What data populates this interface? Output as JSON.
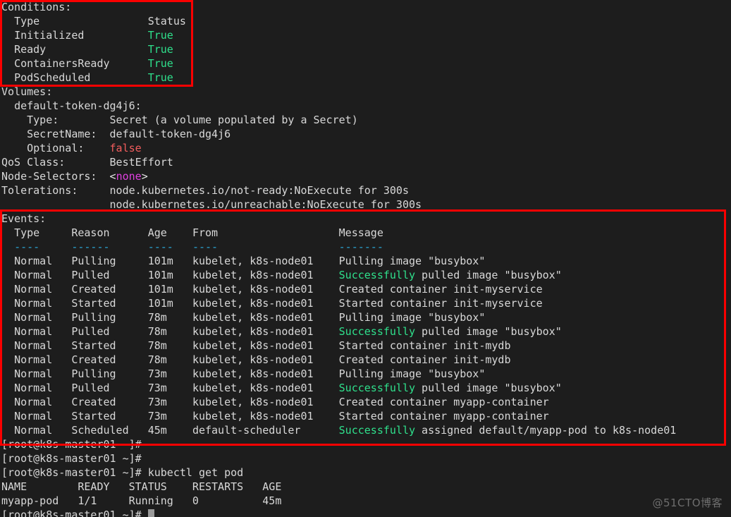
{
  "terminal": {
    "background_color": "#1d1d1d",
    "foreground_color": "#d8d8d8",
    "accent_colors": {
      "true_green": "#2fe08c",
      "false_red": "#f25d5d",
      "none_magenta": "#e040e0",
      "header_rule_cyan": "#2ba8d8",
      "annotation_red": "#fa0000"
    }
  },
  "conditions": {
    "heading": "Conditions:",
    "columns": {
      "type": "Type",
      "status": "Status"
    },
    "rows": [
      {
        "type": "Initialized",
        "status": "True"
      },
      {
        "type": "Ready",
        "status": "True"
      },
      {
        "type": "ContainersReady",
        "status": "True"
      },
      {
        "type": "PodScheduled",
        "status": "True"
      }
    ]
  },
  "volumes": {
    "heading": "Volumes:",
    "name": "default-token-dg4j6:",
    "fields": [
      {
        "key": "Type:",
        "value": "Secret (a volume populated by a Secret)"
      },
      {
        "key": "SecretName:",
        "value": "default-token-dg4j6"
      },
      {
        "key": "Optional:",
        "value": "false"
      }
    ]
  },
  "pod_meta": {
    "qos_label": "QoS Class:",
    "qos_value": "BestEffort",
    "node_selectors_label": "Node-Selectors:",
    "node_selectors_value": "<none>",
    "tolerations_label": "Tolerations:",
    "tolerations_values": [
      "node.kubernetes.io/not-ready:NoExecute for 300s",
      "node.kubernetes.io/unreachable:NoExecute for 300s"
    ]
  },
  "events": {
    "heading": "Events:",
    "columns": [
      "Type",
      "Reason",
      "Age",
      "From",
      "Message"
    ],
    "rules": [
      "----",
      "------",
      "----",
      "----",
      "-------"
    ],
    "rows": [
      {
        "type": "Normal",
        "reason": "Pulling",
        "age": "101m",
        "from": "kubelet, k8s-node01",
        "message_highlight": "",
        "message": "Pulling image \"busybox\""
      },
      {
        "type": "Normal",
        "reason": "Pulled",
        "age": "101m",
        "from": "kubelet, k8s-node01",
        "message_highlight": "Successfully",
        "message": " pulled image \"busybox\""
      },
      {
        "type": "Normal",
        "reason": "Created",
        "age": "101m",
        "from": "kubelet, k8s-node01",
        "message_highlight": "",
        "message": "Created container init-myservice"
      },
      {
        "type": "Normal",
        "reason": "Started",
        "age": "101m",
        "from": "kubelet, k8s-node01",
        "message_highlight": "",
        "message": "Started container init-myservice"
      },
      {
        "type": "Normal",
        "reason": "Pulling",
        "age": "78m",
        "from": "kubelet, k8s-node01",
        "message_highlight": "",
        "message": "Pulling image \"busybox\""
      },
      {
        "type": "Normal",
        "reason": "Pulled",
        "age": "78m",
        "from": "kubelet, k8s-node01",
        "message_highlight": "Successfully",
        "message": " pulled image \"busybox\""
      },
      {
        "type": "Normal",
        "reason": "Started",
        "age": "78m",
        "from": "kubelet, k8s-node01",
        "message_highlight": "",
        "message": "Started container init-mydb"
      },
      {
        "type": "Normal",
        "reason": "Created",
        "age": "78m",
        "from": "kubelet, k8s-node01",
        "message_highlight": "",
        "message": "Created container init-mydb"
      },
      {
        "type": "Normal",
        "reason": "Pulling",
        "age": "73m",
        "from": "kubelet, k8s-node01",
        "message_highlight": "",
        "message": "Pulling image \"busybox\""
      },
      {
        "type": "Normal",
        "reason": "Pulled",
        "age": "73m",
        "from": "kubelet, k8s-node01",
        "message_highlight": "Successfully",
        "message": " pulled image \"busybox\""
      },
      {
        "type": "Normal",
        "reason": "Created",
        "age": "73m",
        "from": "kubelet, k8s-node01",
        "message_highlight": "",
        "message": "Created container myapp-container"
      },
      {
        "type": "Normal",
        "reason": "Started",
        "age": "73m",
        "from": "kubelet, k8s-node01",
        "message_highlight": "",
        "message": "Started container myapp-container"
      },
      {
        "type": "Normal",
        "reason": "Scheduled",
        "age": "45m",
        "from": "default-scheduler",
        "message_highlight": "Successfully",
        "message": " assigned default/myapp-pod to k8s-node01"
      }
    ]
  },
  "shell": {
    "prompt": "[root@k8s-master01 ~]#",
    "blank_prompt_1": "[root@k8s-master01 ~]#",
    "blank_prompt_2": "[root@k8s-master01 ~]#",
    "command_prompt": "[root@k8s-master01 ~]# ",
    "command": "kubectl get pod",
    "final_prompt": "[root@k8s-master01 ~]# "
  },
  "get_pod_table": {
    "header": [
      "NAME",
      "READY",
      "STATUS",
      "RESTARTS",
      "AGE"
    ],
    "header_line": "NAME        READY   STATUS    RESTARTS   AGE",
    "rows": [
      {
        "line": "myapp-pod   1/1     Running   0          45m",
        "name": "myapp-pod",
        "ready": "1/1",
        "status": "Running",
        "restarts": "0",
        "age": "45m"
      }
    ]
  },
  "watermark": {
    "text": "@51CTO博客"
  }
}
